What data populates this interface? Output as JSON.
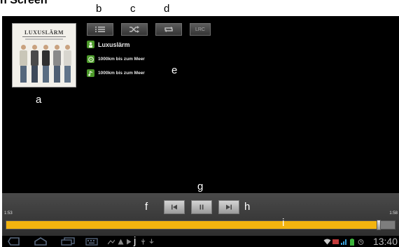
{
  "header": {
    "title_fragment": "n Screen"
  },
  "callouts": {
    "a": "a",
    "b": "b",
    "c": "c",
    "d": "d",
    "e": "e",
    "f": "f",
    "g": "g",
    "h": "h",
    "i": "i",
    "j": "j"
  },
  "album": {
    "title": "LUXUSLÄRM"
  },
  "toolbar": {
    "lrc_label": "LRC"
  },
  "track_info": {
    "artist": "Luxuslärm",
    "album": "1000km bis zum Meer",
    "title": "1000km bis zum Meer"
  },
  "player": {
    "elapsed": "1:53",
    "duration": "1:58",
    "progress_fraction": 0.955
  },
  "status_bar": {
    "time": "13:40"
  },
  "colors": {
    "accent": "#f3b40f",
    "background": "#000000",
    "icon_green": "#4c9a2a"
  },
  "icons": [
    "playlist-icon",
    "shuffle-icon",
    "repeat-icon",
    "previous-icon",
    "pause-icon",
    "next-icon",
    "back-icon",
    "home-icon",
    "recent-apps-icon",
    "keyboard-icon",
    "wifi-icon",
    "signal-icon",
    "battery-icon",
    "alarm-icon"
  ]
}
